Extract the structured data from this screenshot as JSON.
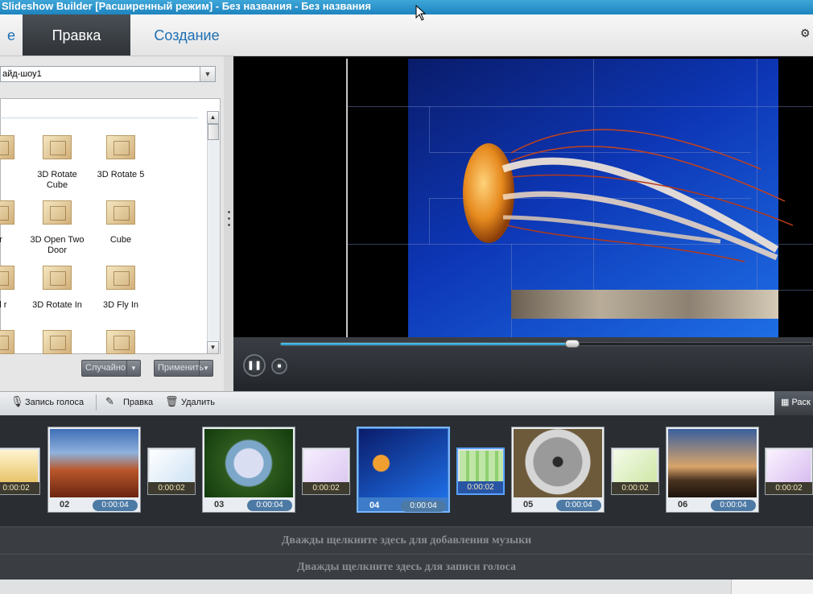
{
  "window": {
    "title": "Slideshow Builder [Расширенный режим] - Без названия - Без названия"
  },
  "tabs": [
    {
      "label": "е"
    },
    {
      "label": "Правка"
    },
    {
      "label": "Создание"
    }
  ],
  "left_panel": {
    "combo_value": "айд-шоу1",
    "effects": [
      {
        "label": "tate"
      },
      {
        "label": "3D Rotate Cube"
      },
      {
        "label": "3D Rotate 5"
      },
      {
        "label": "Door"
      },
      {
        "label": "3D Open Two Door"
      },
      {
        "label": "Cube"
      },
      {
        "label": "e And r"
      },
      {
        "label": "3D Rotate In"
      },
      {
        "label": "3D Fly In"
      }
    ],
    "random_button": "Случайно",
    "apply_button": "Применить"
  },
  "player": {
    "progress": 0.55
  },
  "storyboard_toolbar": {
    "record_voice": "Запись голоса",
    "edit": "Правка",
    "delete": "Удалить",
    "layout": "Раск"
  },
  "storyboard": {
    "transitions": [
      {
        "duration": "0:00:02"
      },
      {
        "duration": "0:00:02"
      },
      {
        "duration": "0:00:02"
      },
      {
        "duration": "0:00:02"
      },
      {
        "duration": "0:00:02"
      },
      {
        "duration": "0:00:02"
      }
    ],
    "slides": [
      {
        "number": "02",
        "duration": "0:00:04"
      },
      {
        "number": "03",
        "duration": "0:00:04"
      },
      {
        "number": "04",
        "duration": "0:00:04"
      },
      {
        "number": "05",
        "duration": "0:00:04"
      },
      {
        "number": "06",
        "duration": "0:00:04"
      }
    ]
  },
  "tracks": {
    "music_hint": "Дважды щелкните здесь для добавления музыки",
    "voice_hint": "Дважды щелкните здесь для записи голоса"
  }
}
